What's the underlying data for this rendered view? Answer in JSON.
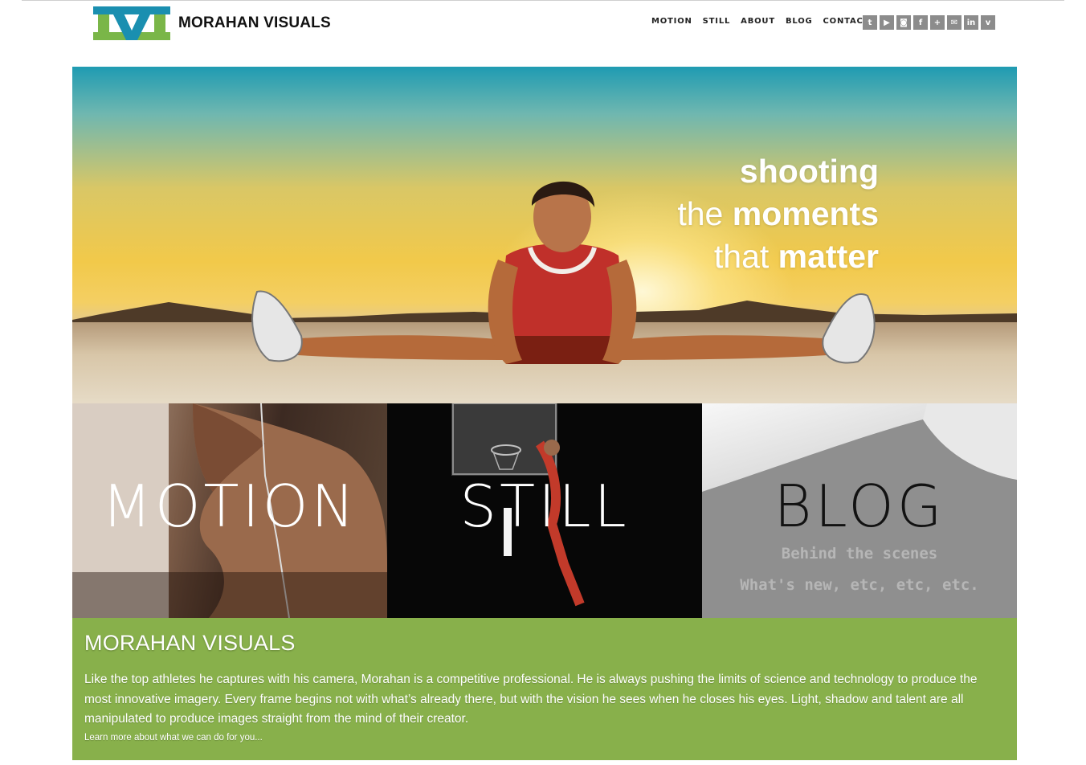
{
  "brand": {
    "name": "MORAHAN VISUALS",
    "logo_letter": "M",
    "colors": {
      "green": "#7ab648",
      "blue": "#1a8fb0"
    }
  },
  "nav": {
    "items": [
      "MOTION",
      "STILL",
      "ABOUT",
      "BLOG",
      "CONTACT"
    ]
  },
  "social": {
    "icons": [
      "twitter-icon",
      "youtube-icon",
      "instagram-icon",
      "facebook-icon",
      "google-plus-icon",
      "email-icon",
      "linkedin-icon",
      "vimeo-icon"
    ]
  },
  "hero": {
    "line1_bold": "shooting",
    "line2_light": "the",
    "line2_bold": "moments",
    "line3_light": "that",
    "line3_bold": "matter"
  },
  "tiles": {
    "motion": "MOTION",
    "still": "STILL",
    "blog": "BLOG",
    "blog_line1": "Behind the scenes",
    "blog_line2": "What's new, etc, etc, etc."
  },
  "about": {
    "title": "MORAHAN VISUALS",
    "body": "Like the top athletes he captures with his camera, Morahan is a competitive professional. He is always pushing the limits of science and technology to produce the most innovative imagery. Every frame begins not with what’s already there, but with the vision he sees when he closes his eyes. Light, shadow and talent are all manipulated to produce images straight from the mind of their creator.",
    "link": "Learn more about what we can do for you..."
  }
}
